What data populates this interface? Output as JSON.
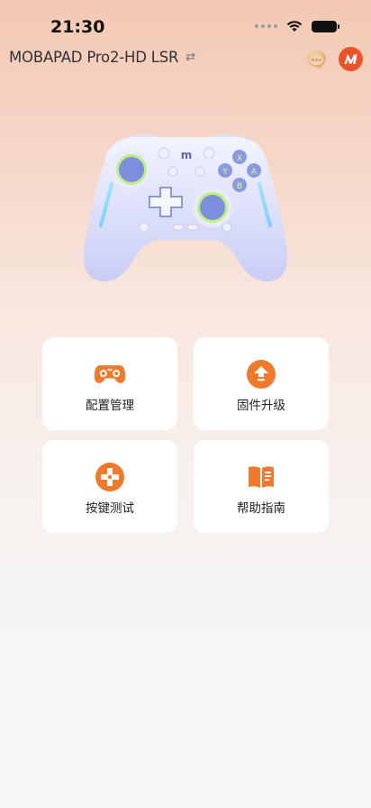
{
  "status_bar": {
    "time": "21:30"
  },
  "header": {
    "device_name": "MOBAPAD Pro2-HD LSR",
    "swap_symbol": "⇄"
  },
  "controller": {
    "face_buttons": [
      "X",
      "Y",
      "A",
      "B"
    ]
  },
  "menu": {
    "items": [
      {
        "label": "配置管理",
        "icon": "gamepad-icon"
      },
      {
        "label": "固件升级",
        "icon": "upgrade-icon"
      },
      {
        "label": "按键测试",
        "icon": "dpad-test-icon"
      },
      {
        "label": "帮助指南",
        "icon": "book-icon"
      }
    ]
  },
  "colors": {
    "accent": "#f07a2c",
    "brand": "#e8552b",
    "card_bg": "#ffffff"
  }
}
